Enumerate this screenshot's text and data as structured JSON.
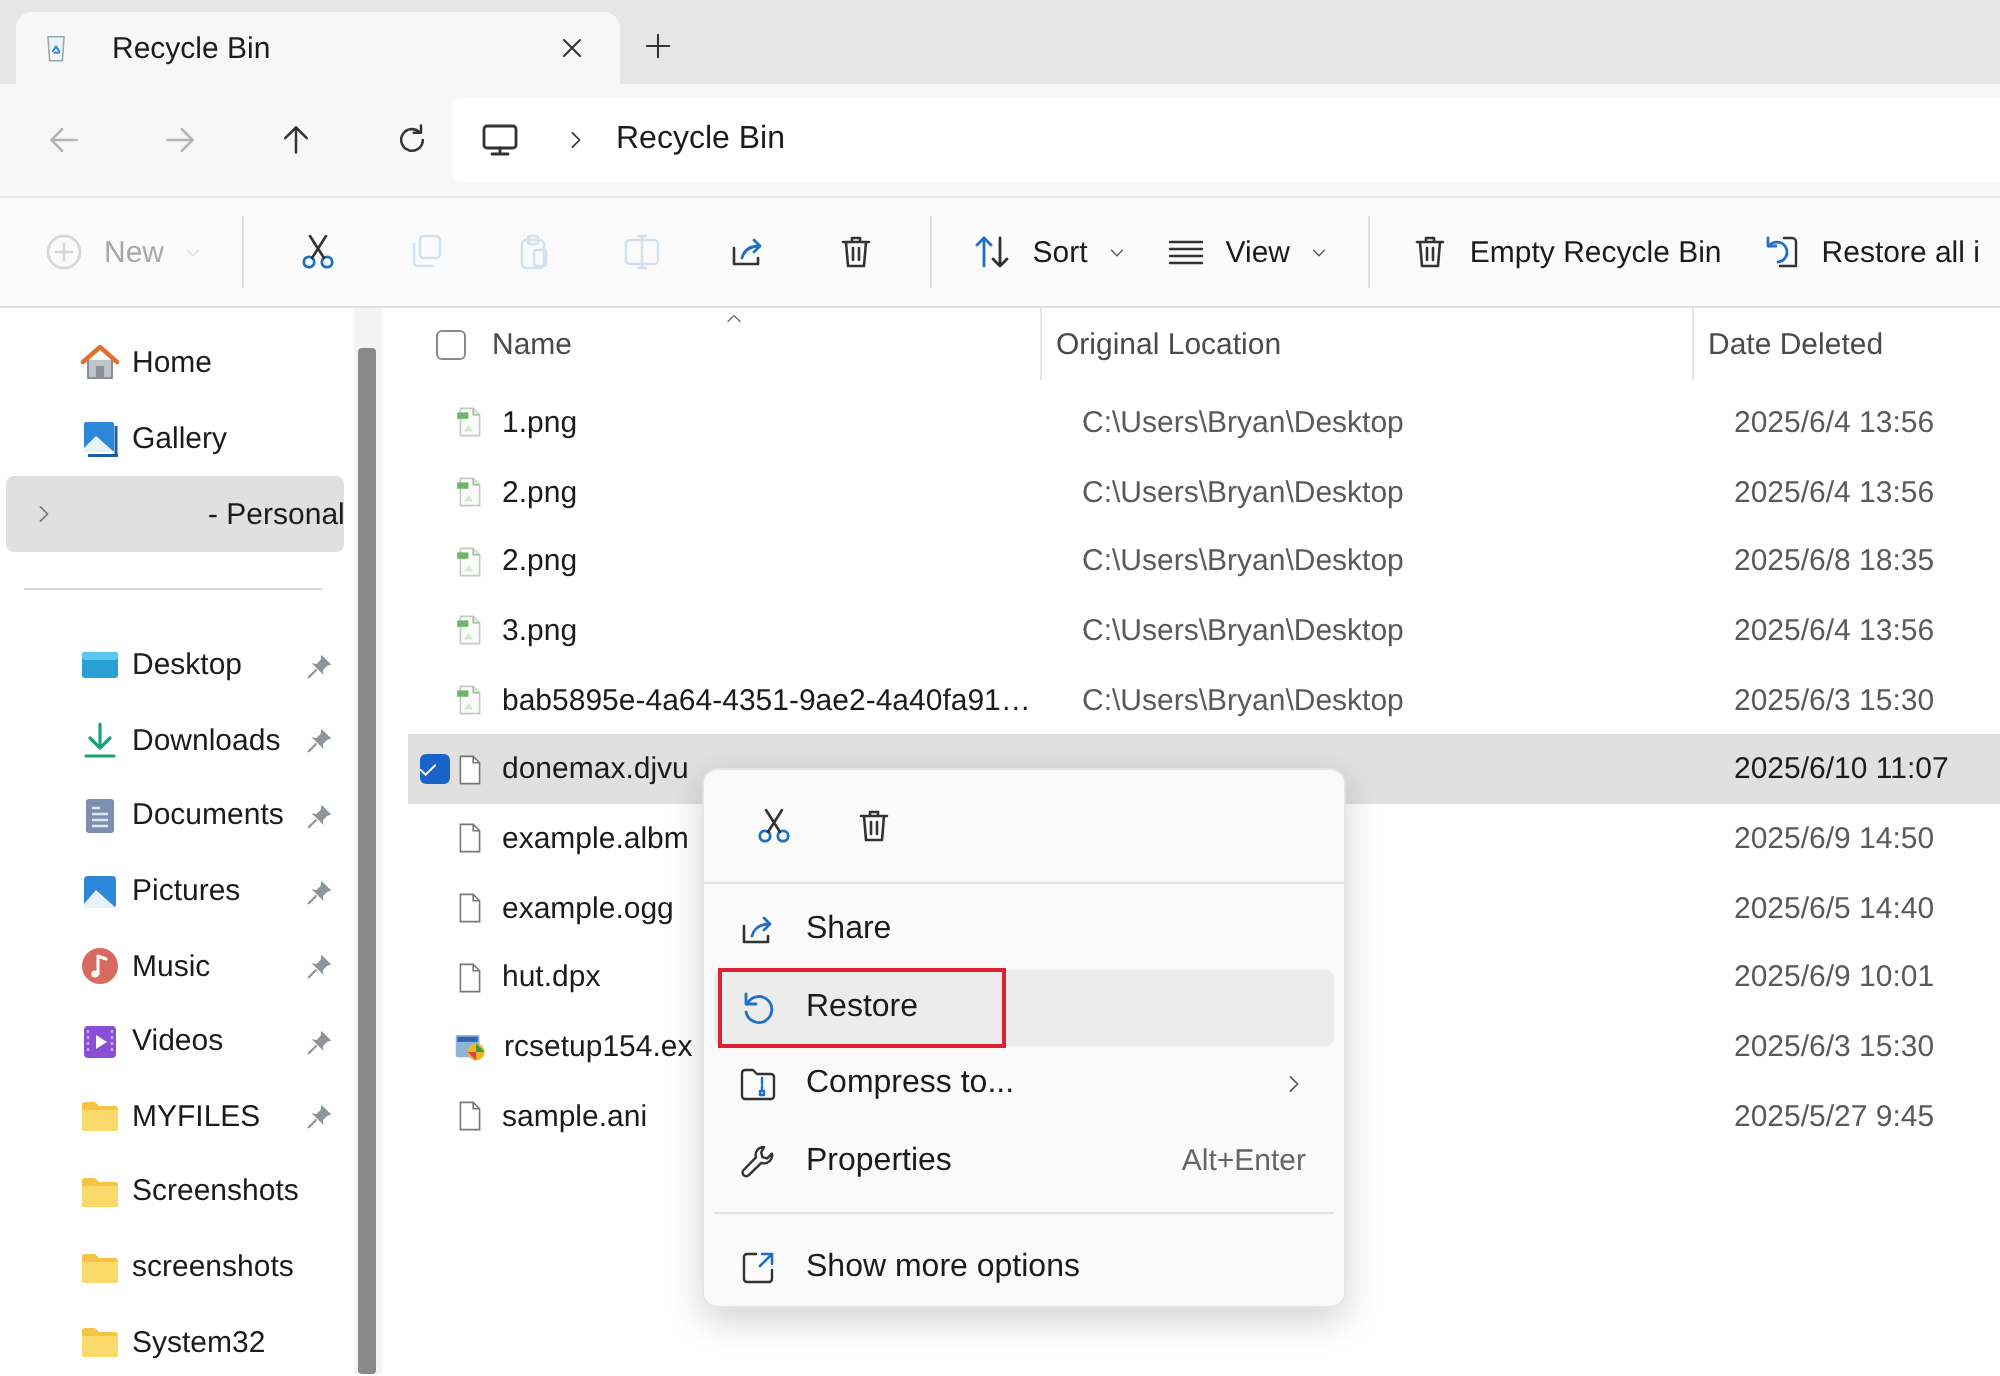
{
  "tab": {
    "title": "Recycle Bin"
  },
  "address": {
    "path": [
      "Recycle Bin"
    ]
  },
  "toolbar": {
    "items": [
      {
        "kind": "label",
        "label": "New",
        "disabled": true,
        "dropdown": true
      },
      {
        "kind": "separator"
      },
      {
        "kind": "icon",
        "disabled": false
      },
      {
        "kind": "icon",
        "disabled": true
      },
      {
        "kind": "icon",
        "disabled": true
      },
      {
        "kind": "icon",
        "disabled": true
      },
      {
        "kind": "icon",
        "disabled": false
      },
      {
        "kind": "icon",
        "disabled": false
      },
      {
        "kind": "separator"
      },
      {
        "kind": "label",
        "label": "Sort",
        "disabled": false,
        "dropdown": true
      },
      {
        "kind": "label",
        "label": "View",
        "disabled": false,
        "dropdown": true
      },
      {
        "kind": "separator"
      },
      {
        "kind": "label",
        "label": "Empty Recycle Bin",
        "disabled": false,
        "dropdown": false
      },
      {
        "kind": "label",
        "label": "Restore all i",
        "disabled": false,
        "dropdown": false
      }
    ]
  },
  "sidebar": {
    "top": [
      {
        "label": "Home",
        "selected": false,
        "expandable": false
      },
      {
        "label": "Gallery",
        "selected": false,
        "expandable": false
      },
      {
        "label": "- Personal",
        "selected": true,
        "expandable": true
      }
    ],
    "quick_access": [
      {
        "label": "Desktop",
        "pinned": true
      },
      {
        "label": "Downloads",
        "pinned": true
      },
      {
        "label": "Documents",
        "pinned": true
      },
      {
        "label": "Pictures",
        "pinned": true
      },
      {
        "label": "Music",
        "pinned": true
      },
      {
        "label": "Videos",
        "pinned": true
      },
      {
        "label": "MYFILES",
        "pinned": true
      },
      {
        "label": "Screenshots",
        "pinned": false
      },
      {
        "label": "screenshots",
        "pinned": false
      },
      {
        "label": "System32",
        "pinned": false
      }
    ]
  },
  "table": {
    "select_all": {
      "checked": false
    },
    "columns": [
      {
        "label": "Name",
        "sorted": true
      },
      {
        "label": "Original Location",
        "sorted": false
      },
      {
        "label": "Date Deleted",
        "sorted": false
      }
    ],
    "rows": [
      {
        "name": "1.png",
        "kind": "image",
        "location": "C:\\Users\\Bryan\\Desktop",
        "date": "2025/6/4 13:56",
        "selected": false
      },
      {
        "name": "2.png",
        "kind": "image",
        "location": "C:\\Users\\Bryan\\Desktop",
        "date": "2025/6/4 13:56",
        "selected": false
      },
      {
        "name": "2.png",
        "kind": "image",
        "location": "C:\\Users\\Bryan\\Desktop",
        "date": "2025/6/8 18:35",
        "selected": false
      },
      {
        "name": "3.png",
        "kind": "image",
        "location": "C:\\Users\\Bryan\\Desktop",
        "date": "2025/6/4 13:56",
        "selected": false
      },
      {
        "name": "bab5895e-4a64-4351-9ae2-4a40fa91…",
        "kind": "image",
        "location": "C:\\Users\\Bryan\\Desktop",
        "date": "2025/6/3 15:30",
        "selected": false
      },
      {
        "name": "donemax.djvu",
        "kind": "file",
        "date": "2025/6/10 11:07",
        "selected": true
      },
      {
        "name": "example.albm",
        "kind": "file",
        "date": "2025/6/9 14:50",
        "selected": false
      },
      {
        "name": "example.ogg",
        "kind": "file",
        "date": "2025/6/5 14:40",
        "selected": false
      },
      {
        "name": "hut.dpx",
        "kind": "file",
        "date": "2025/6/9 10:01",
        "selected": false
      },
      {
        "name": "rcsetup154.ex",
        "kind": "program",
        "date": "2025/6/3 15:30",
        "selected": false
      },
      {
        "name": "sample.ani",
        "kind": "file",
        "date": "2025/5/27 9:45",
        "selected": false
      }
    ]
  },
  "context_menu": {
    "items": [
      {
        "kind": "item",
        "label": "Share",
        "highlighted": false,
        "outlined": false
      },
      {
        "kind": "item",
        "label": "Restore",
        "highlighted": true,
        "outlined": true
      },
      {
        "kind": "item",
        "label": "Compress to...",
        "highlighted": false,
        "outlined": false,
        "submenu": true
      },
      {
        "kind": "item",
        "label": "Properties",
        "highlighted": false,
        "outlined": false,
        "shortcut": "Alt+Enter"
      },
      {
        "kind": "separator"
      },
      {
        "kind": "item",
        "label": "Show more options",
        "highlighted": false,
        "outlined": false
      }
    ]
  }
}
